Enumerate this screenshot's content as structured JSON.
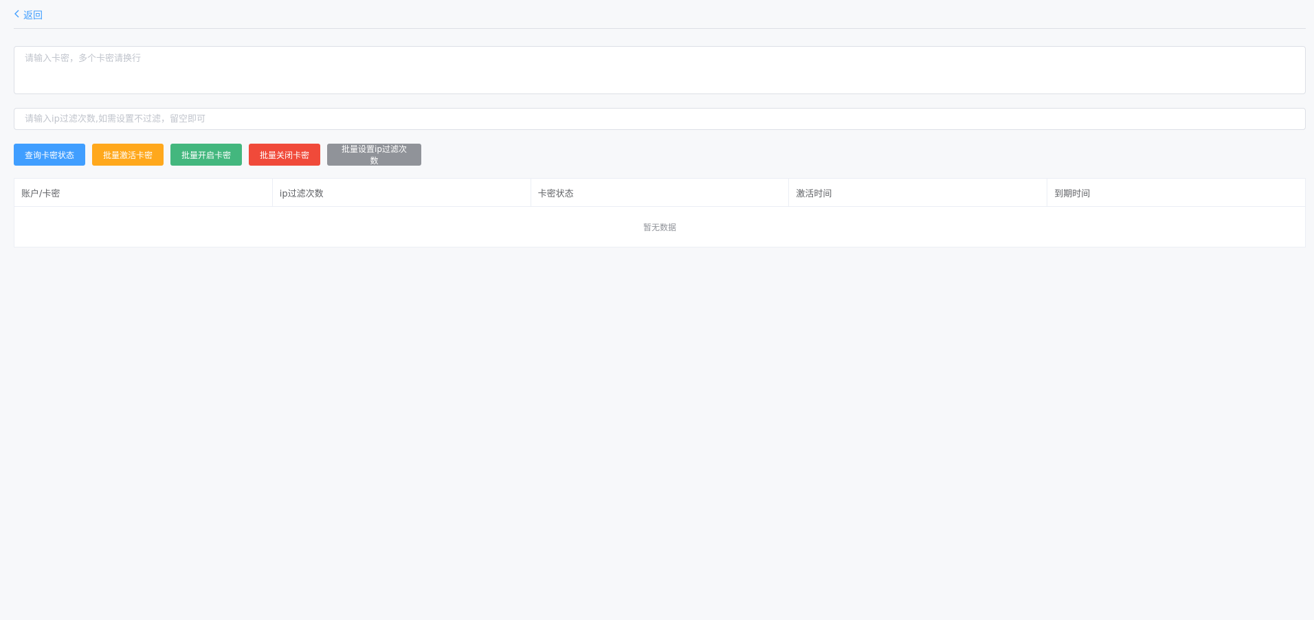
{
  "header": {
    "back_label": "返回"
  },
  "form": {
    "card_placeholder": "请输入卡密，多个卡密请换行",
    "card_value": "",
    "ip_placeholder": "请输入ip过滤次数,如需设置不过滤，留空即可",
    "ip_value": ""
  },
  "actions": {
    "query_label": "查询卡密状态",
    "activate_label": "批量激活卡密",
    "enable_label": "批量开启卡密",
    "disable_label": "批量关闭卡密",
    "set_ip_label": "批量设置ip过滤次数"
  },
  "table": {
    "columns": [
      "账户/卡密",
      "ip过滤次数",
      "卡密状态",
      "激活时间",
      "到期时间"
    ],
    "rows": [],
    "empty_text": "暂无数据"
  },
  "colors": {
    "primary": "#409eff",
    "warning": "#ffa81c",
    "success": "#43b77e",
    "danger": "#f04a3a",
    "info": "#909399"
  },
  "icons": {
    "back": "chevron-left-icon"
  }
}
